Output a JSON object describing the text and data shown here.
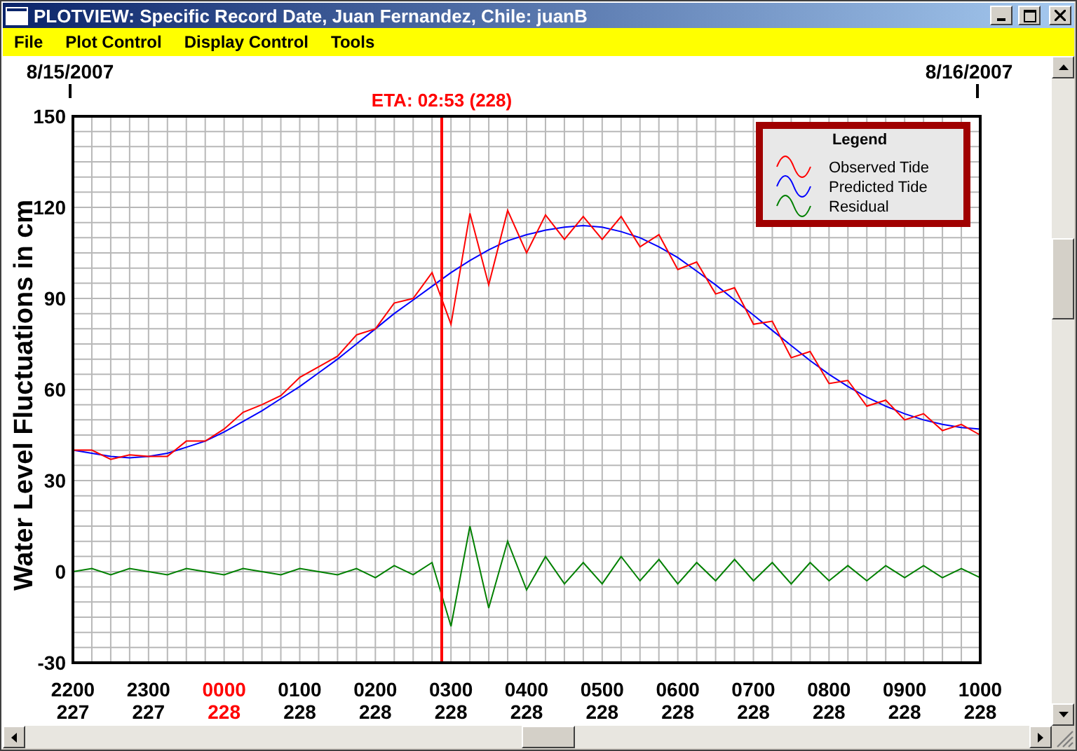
{
  "window": {
    "title": "PLOTVIEW: Specific Record Date, Juan Fernandez, Chile: juanB"
  },
  "menu": [
    "File",
    "Plot Control",
    "Display Control",
    "Tools"
  ],
  "plot": {
    "start_date": "8/15/2007",
    "end_date": "8/16/2007",
    "x_labels": [
      {
        "day": "227",
        "highlighted": false
      },
      {
        "day": "227",
        "highlighted": false
      },
      {
        "day": "228",
        "highlighted": true
      },
      {
        "day": "228",
        "highlighted": false
      },
      {
        "day": "228",
        "highlighted": false
      },
      {
        "day": "228",
        "highlighted": false
      },
      {
        "day": "228",
        "highlighted": false
      },
      {
        "day": "228",
        "highlighted": false
      },
      {
        "day": "228",
        "highlighted": false
      },
      {
        "day": "228",
        "highlighted": false
      },
      {
        "day": "228",
        "highlighted": false
      },
      {
        "day": "228",
        "highlighted": false
      },
      {
        "day": "228",
        "highlighted": false
      }
    ],
    "chart_data": {
      "type": "line",
      "grid": true,
      "legend": {
        "title": "Legend"
      },
      "ylabel": "Water Level Fluctuations in cm",
      "ylim": [
        -30,
        150
      ],
      "yticks": [
        -30,
        0,
        30,
        60,
        90,
        120,
        150
      ],
      "categories": [
        "2200",
        null,
        null,
        null,
        "2300",
        null,
        null,
        null,
        "0000",
        null,
        null,
        null,
        "0100",
        null,
        null,
        null,
        "0200",
        null,
        null,
        null,
        "0300",
        null,
        null,
        null,
        "0400",
        null,
        null,
        null,
        "0500",
        null,
        null,
        null,
        "0600",
        null,
        null,
        null,
        "0700",
        null,
        null,
        null,
        "0800",
        null,
        null,
        null,
        "0900",
        null,
        null,
        null,
        "1000"
      ],
      "series": [
        {
          "name": "Observed Tide",
          "color": "#ff0000",
          "values": [
            40,
            40,
            37,
            38.5,
            38,
            38,
            43,
            43,
            47,
            52.5,
            55,
            58,
            64,
            67.5,
            71,
            78,
            80,
            88.5,
            90,
            98.5,
            81.5,
            118,
            94.5,
            119,
            105,
            117.5,
            109.5,
            117,
            109.5,
            117,
            107,
            111,
            99.5,
            102,
            91.5,
            93.5,
            81.5,
            82.5,
            70.5,
            72.5,
            62,
            63,
            54.5,
            56.5,
            50,
            52,
            46.5,
            48.5,
            45
          ]
        },
        {
          "name": "Predicted Tide",
          "color": "#0000ff",
          "values": [
            40,
            39,
            38,
            37.5,
            38,
            39,
            41,
            43,
            46,
            49.5,
            53,
            57,
            61,
            65.5,
            70,
            75,
            80,
            85,
            89.5,
            94,
            98.5,
            102.5,
            106,
            109,
            111,
            112.5,
            113.5,
            114,
            113.5,
            112,
            110,
            107,
            103.5,
            99,
            94.5,
            89.5,
            84.5,
            79.5,
            74.5,
            69.5,
            65,
            61,
            57.5,
            54.5,
            52,
            50,
            48.5,
            47.5,
            47
          ]
        },
        {
          "name": "Residual",
          "color": "#008000",
          "values": [
            0,
            1,
            -1,
            1,
            0,
            -1,
            1,
            0,
            -1,
            1,
            0,
            -1,
            1,
            0,
            -1,
            1,
            -2,
            2,
            -1,
            3,
            -18,
            15,
            -12,
            10,
            -6,
            5,
            -4,
            3,
            -4,
            5,
            -3,
            4,
            -4,
            3,
            -3,
            4,
            -3,
            3,
            -4,
            3,
            -3,
            2,
            -3,
            2,
            -2,
            2,
            -2,
            1,
            -2
          ]
        }
      ],
      "annotations": [
        "ETA: 02:53 (228)"
      ]
    }
  }
}
